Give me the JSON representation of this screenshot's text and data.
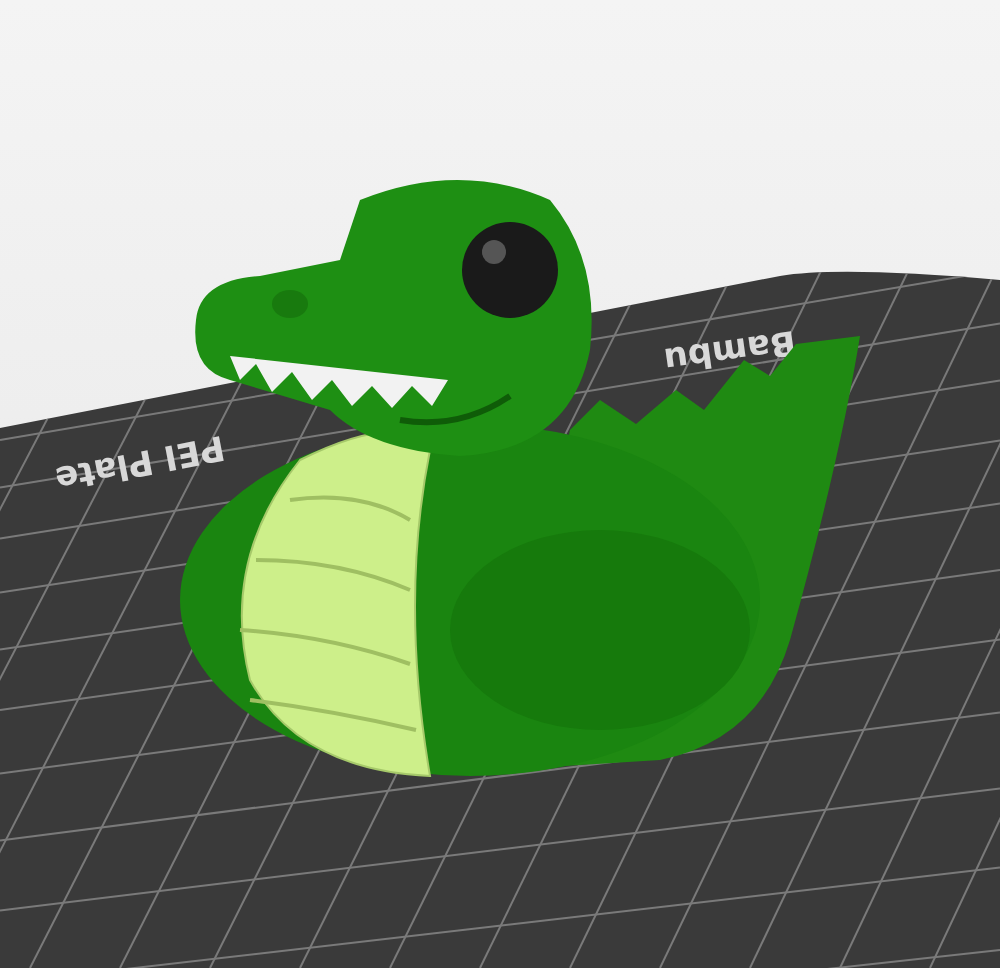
{
  "viewport": {
    "plate": {
      "labels": [
        "Bambu",
        "PEI Plate"
      ]
    }
  }
}
